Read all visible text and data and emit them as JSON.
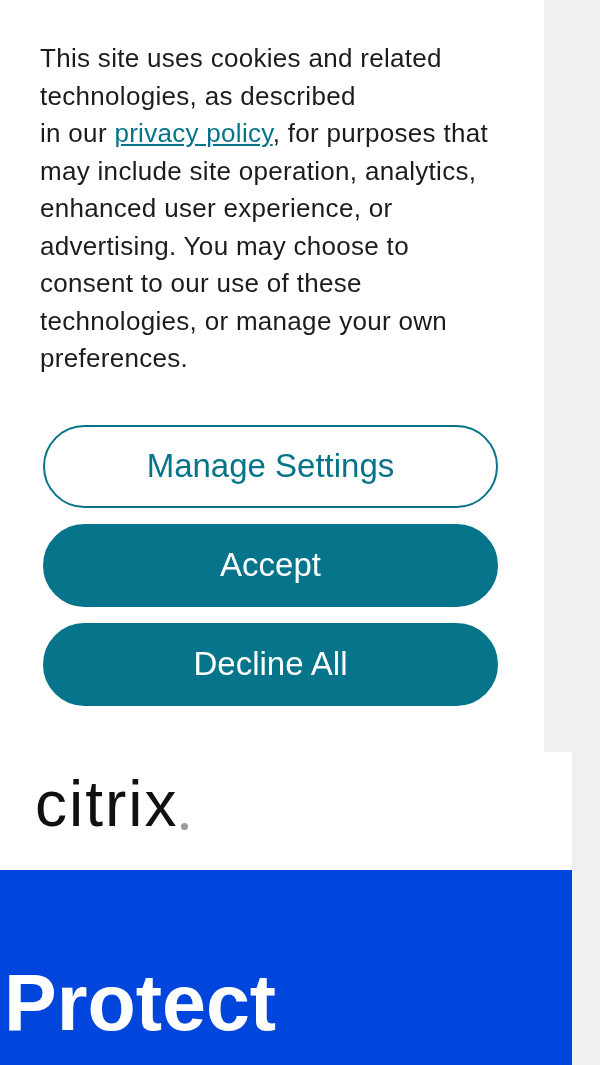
{
  "cookie_banner": {
    "message": {
      "text_before": "This site uses cookies and related technologies, as described\nin our ",
      "link": "privacy policy",
      "text_after": ", for purposes that may include site operation, analytics, enhanced user experience, or advertising. You may choose to consent to our use of these technologies, or manage your own preferences."
    },
    "buttons": [
      {
        "label": "Manage Settings",
        "kind": "outline"
      },
      {
        "label": "Accept",
        "kind": "filled"
      },
      {
        "label": "Decline All",
        "kind": "filled"
      }
    ]
  },
  "header": {
    "logo": "citrix"
  },
  "hero": {
    "heading": "Protect"
  }
}
